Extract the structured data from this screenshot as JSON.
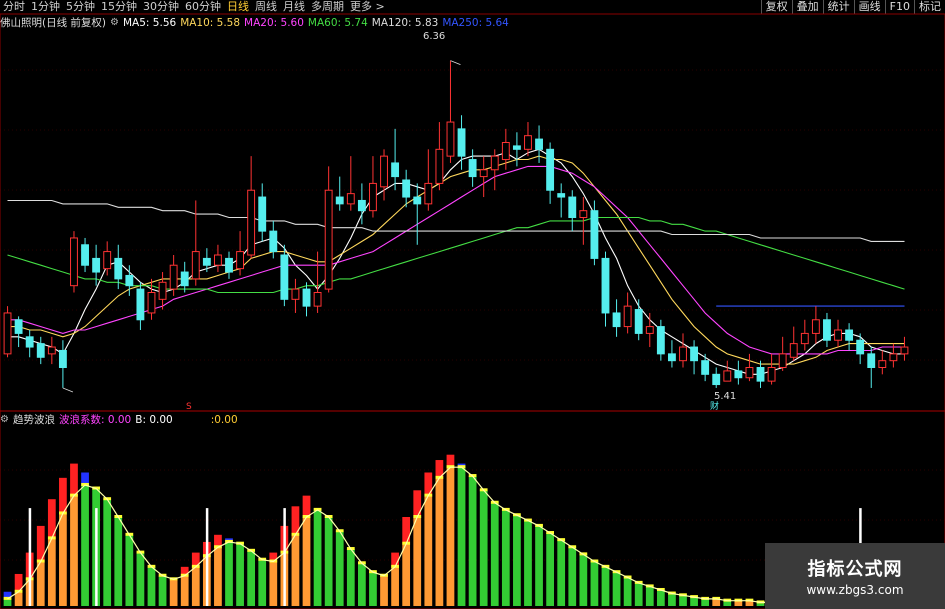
{
  "toolbar": {
    "tabs": [
      "分时",
      "1分钟",
      "5分钟",
      "15分钟",
      "30分钟",
      "60分钟",
      "日线",
      "周线",
      "月线",
      "多周期",
      "更多"
    ],
    "active_tab": "日线",
    "more_arrow": ">",
    "right_buttons": [
      "复权",
      "叠加",
      "统计",
      "画线",
      "F10",
      "标记"
    ]
  },
  "chart_header": {
    "stock": "佛山照明(日线 前复权)",
    "ma": [
      {
        "label": "MA5: 5.56",
        "color": "#ffffff"
      },
      {
        "label": "MA10: 5.58",
        "color": "#ffd85c"
      },
      {
        "label": "MA20: 5.60",
        "color": "#ff44ff"
      },
      {
        "label": "MA60: 5.74",
        "color": "#44dd44"
      },
      {
        "label": "MA120: 5.83",
        "color": "#dddddd"
      },
      {
        "label": "MA250: 5.64",
        "color": "#3355ff"
      }
    ]
  },
  "price_annotations": {
    "high": "6.36",
    "low": "5.41",
    "marker_s": "S",
    "marker_cai": "财"
  },
  "indicator_header": {
    "name": "趋势波浪",
    "params": [
      {
        "label": "波浪系数: 0.00",
        "color": "#ff44ff"
      },
      {
        "label": "B: 0.00",
        "color": "#ffffff"
      },
      {
        "label": ":0.00",
        "color": "#ffcc33"
      }
    ]
  },
  "watermark": {
    "title": "指标公式网",
    "url": "www.zbgs3.com"
  },
  "colors": {
    "up": "#ff3333",
    "down": "#55eeee",
    "ma5": "#ffffff",
    "ma10": "#ffd85c",
    "ma20": "#ff44ff",
    "ma60": "#44dd44",
    "ma120": "#dddddd",
    "ma250": "#3355ff",
    "grid": "#5a0000"
  },
  "chart_data": [
    {
      "type": "candlestick",
      "title": "佛山照明(日线 前复权)",
      "high_label": 6.36,
      "low_label": 5.41,
      "ylim": [
        5.35,
        6.45
      ],
      "candles": [
        [
          5.5,
          5.62,
          5.64,
          5.49
        ],
        [
          5.6,
          5.56,
          5.61,
          5.52
        ],
        [
          5.55,
          5.52,
          5.57,
          5.49
        ],
        [
          5.53,
          5.49,
          5.55,
          5.47
        ],
        [
          5.5,
          5.52,
          5.55,
          5.47
        ],
        [
          5.51,
          5.46,
          5.54,
          5.4
        ],
        [
          5.7,
          5.84,
          5.86,
          5.68
        ],
        [
          5.82,
          5.76,
          5.84,
          5.74
        ],
        [
          5.78,
          5.74,
          5.82,
          5.7
        ],
        [
          5.75,
          5.8,
          5.83,
          5.73
        ],
        [
          5.78,
          5.72,
          5.82,
          5.69
        ],
        [
          5.73,
          5.7,
          5.76,
          5.67
        ],
        [
          5.69,
          5.6,
          5.71,
          5.57
        ],
        [
          5.62,
          5.68,
          5.72,
          5.6
        ],
        [
          5.66,
          5.71,
          5.74,
          5.63
        ],
        [
          5.69,
          5.76,
          5.79,
          5.67
        ],
        [
          5.74,
          5.7,
          5.77,
          5.68
        ],
        [
          5.72,
          5.8,
          5.95,
          5.7
        ],
        [
          5.78,
          5.76,
          5.81,
          5.74
        ],
        [
          5.76,
          5.79,
          5.82,
          5.74
        ],
        [
          5.78,
          5.74,
          5.8,
          5.72
        ],
        [
          5.75,
          5.8,
          5.86,
          5.73
        ],
        [
          5.79,
          5.98,
          6.08,
          5.78
        ],
        [
          5.96,
          5.86,
          6.0,
          5.83
        ],
        [
          5.86,
          5.8,
          5.89,
          5.78
        ],
        [
          5.79,
          5.66,
          5.82,
          5.64
        ],
        [
          5.66,
          5.69,
          5.72,
          5.62
        ],
        [
          5.69,
          5.64,
          5.71,
          5.61
        ],
        [
          5.64,
          5.68,
          5.8,
          5.62
        ],
        [
          5.69,
          5.98,
          6.05,
          5.68
        ],
        [
          5.96,
          5.94,
          6.02,
          5.92
        ],
        [
          5.94,
          5.97,
          6.08,
          5.92
        ],
        [
          5.95,
          5.92,
          6.0,
          5.88
        ],
        [
          5.92,
          6.0,
          6.08,
          5.9
        ],
        [
          5.99,
          6.08,
          6.1,
          5.95
        ],
        [
          6.06,
          6.02,
          6.16,
          5.98
        ],
        [
          6.01,
          5.96,
          6.04,
          5.93
        ],
        [
          5.96,
          5.94,
          6.0,
          5.82
        ],
        [
          5.94,
          6.0,
          6.1,
          5.92
        ],
        [
          6.0,
          6.1,
          6.18,
          5.98
        ],
        [
          6.08,
          6.18,
          6.36,
          6.06
        ],
        [
          6.16,
          6.08,
          6.2,
          6.04
        ],
        [
          6.07,
          6.02,
          6.1,
          5.99
        ],
        [
          6.02,
          6.04,
          6.08,
          5.96
        ],
        [
          6.04,
          6.08,
          6.1,
          5.98
        ],
        [
          6.07,
          6.12,
          6.16,
          6.04
        ],
        [
          6.11,
          6.1,
          6.15,
          6.05
        ],
        [
          6.1,
          6.14,
          6.18,
          6.08
        ],
        [
          6.13,
          6.1,
          6.17,
          6.06
        ],
        [
          6.1,
          5.98,
          6.12,
          5.94
        ],
        [
          5.97,
          5.96,
          6.0,
          5.9
        ],
        [
          5.96,
          5.9,
          5.98,
          5.86
        ],
        [
          5.9,
          5.92,
          5.96,
          5.82
        ],
        [
          5.92,
          5.78,
          5.95,
          5.76
        ],
        [
          5.78,
          5.62,
          5.8,
          5.58
        ],
        [
          5.62,
          5.58,
          5.66,
          5.55
        ],
        [
          5.58,
          5.64,
          5.68,
          5.56
        ],
        [
          5.63,
          5.56,
          5.66,
          5.54
        ],
        [
          5.56,
          5.58,
          5.62,
          5.52
        ],
        [
          5.58,
          5.5,
          5.6,
          5.48
        ],
        [
          5.5,
          5.48,
          5.54,
          5.46
        ],
        [
          5.48,
          5.52,
          5.56,
          5.46
        ],
        [
          5.52,
          5.48,
          5.54,
          5.44
        ],
        [
          5.48,
          5.44,
          5.5,
          5.42
        ],
        [
          5.44,
          5.41,
          5.46,
          5.4
        ],
        [
          5.42,
          5.45,
          5.48,
          5.42
        ],
        [
          5.45,
          5.43,
          5.48,
          5.41
        ],
        [
          5.43,
          5.46,
          5.5,
          5.42
        ],
        [
          5.46,
          5.42,
          5.48,
          5.4
        ],
        [
          5.42,
          5.46,
          5.5,
          5.41
        ],
        [
          5.46,
          5.5,
          5.55,
          5.45
        ],
        [
          5.49,
          5.53,
          5.58,
          5.48
        ],
        [
          5.53,
          5.56,
          5.6,
          5.51
        ],
        [
          5.56,
          5.6,
          5.64,
          5.53
        ],
        [
          5.6,
          5.54,
          5.62,
          5.52
        ],
        [
          5.54,
          5.57,
          5.6,
          5.52
        ],
        [
          5.57,
          5.54,
          5.59,
          5.51
        ],
        [
          5.54,
          5.5,
          5.56,
          5.47
        ],
        [
          5.5,
          5.46,
          5.52,
          5.4
        ],
        [
          5.46,
          5.48,
          5.51,
          5.44
        ],
        [
          5.48,
          5.5,
          5.53,
          5.46
        ],
        [
          5.5,
          5.52,
          5.55,
          5.48
        ]
      ],
      "ma_lines": {
        "MA5": [
          5.55,
          5.55,
          5.54,
          5.53,
          5.52,
          5.5,
          5.56,
          5.63,
          5.69,
          5.76,
          5.77,
          5.74,
          5.71,
          5.69,
          5.68,
          5.69,
          5.71,
          5.74,
          5.75,
          5.76,
          5.76,
          5.78,
          5.82,
          5.83,
          5.84,
          5.81,
          5.76,
          5.73,
          5.69,
          5.73,
          5.78,
          5.84,
          5.91,
          5.96,
          5.98,
          6.0,
          6.0,
          5.99,
          5.98,
          6.0,
          6.04,
          6.07,
          6.08,
          6.08,
          6.08,
          6.09,
          6.07,
          6.09,
          6.1,
          6.08,
          6.06,
          6.02,
          5.97,
          5.91,
          5.84,
          5.78,
          5.7,
          5.64,
          5.6,
          5.57,
          5.55,
          5.53,
          5.51,
          5.49,
          5.47,
          5.46,
          5.45,
          5.44,
          5.44,
          5.45,
          5.46,
          5.48,
          5.5,
          5.53,
          5.55,
          5.56,
          5.56,
          5.55,
          5.52,
          5.51,
          5.5,
          5.5
        ],
        "MA10": [
          5.58,
          5.58,
          5.57,
          5.57,
          5.56,
          5.55,
          5.56,
          5.58,
          5.61,
          5.64,
          5.67,
          5.69,
          5.7,
          5.71,
          5.72,
          5.72,
          5.72,
          5.72,
          5.72,
          5.73,
          5.74,
          5.75,
          5.78,
          5.79,
          5.8,
          5.8,
          5.79,
          5.78,
          5.77,
          5.77,
          5.79,
          5.81,
          5.83,
          5.85,
          5.88,
          5.91,
          5.94,
          5.96,
          5.98,
          6.0,
          6.02,
          6.03,
          6.04,
          6.04,
          6.05,
          6.06,
          6.07,
          6.07,
          6.08,
          6.07,
          6.07,
          6.06,
          6.03,
          5.99,
          5.95,
          5.91,
          5.86,
          5.81,
          5.76,
          5.71,
          5.66,
          5.62,
          5.58,
          5.55,
          5.52,
          5.5,
          5.49,
          5.48,
          5.47,
          5.47,
          5.47,
          5.47,
          5.48,
          5.49,
          5.51,
          5.52,
          5.53,
          5.53,
          5.53,
          5.53,
          5.53,
          5.53
        ],
        "MA20": [
          5.6,
          5.6,
          5.59,
          5.58,
          5.57,
          5.56,
          5.57,
          5.57,
          5.58,
          5.59,
          5.6,
          5.61,
          5.62,
          5.63,
          5.64,
          5.66,
          5.67,
          5.68,
          5.69,
          5.7,
          5.71,
          5.72,
          5.73,
          5.74,
          5.75,
          5.76,
          5.76,
          5.76,
          5.76,
          5.76,
          5.77,
          5.78,
          5.79,
          5.8,
          5.82,
          5.84,
          5.86,
          5.88,
          5.9,
          5.92,
          5.94,
          5.96,
          5.98,
          6.0,
          6.02,
          6.03,
          6.04,
          6.05,
          6.05,
          6.05,
          6.04,
          6.03,
          6.01,
          5.99,
          5.96,
          5.93,
          5.9,
          5.86,
          5.82,
          5.78,
          5.74,
          5.7,
          5.66,
          5.62,
          5.59,
          5.56,
          5.54,
          5.52,
          5.51,
          5.5,
          5.5,
          5.5,
          5.5,
          5.5,
          5.5,
          5.51,
          5.51,
          5.51,
          5.51,
          5.52,
          5.52,
          5.52
        ],
        "MA60": [
          5.79,
          5.78,
          5.77,
          5.76,
          5.75,
          5.74,
          5.73,
          5.72,
          5.72,
          5.71,
          5.71,
          5.7,
          5.7,
          5.7,
          5.69,
          5.69,
          5.69,
          5.69,
          5.69,
          5.68,
          5.68,
          5.68,
          5.68,
          5.68,
          5.68,
          5.69,
          5.69,
          5.7,
          5.7,
          5.71,
          5.72,
          5.72,
          5.73,
          5.74,
          5.75,
          5.76,
          5.77,
          5.78,
          5.79,
          5.8,
          5.81,
          5.82,
          5.83,
          5.84,
          5.85,
          5.86,
          5.87,
          5.87,
          5.88,
          5.89,
          5.89,
          5.89,
          5.89,
          5.9,
          5.9,
          5.9,
          5.9,
          5.9,
          5.89,
          5.89,
          5.88,
          5.88,
          5.87,
          5.86,
          5.86,
          5.85,
          5.84,
          5.83,
          5.82,
          5.81,
          5.8,
          5.79,
          5.78,
          5.77,
          5.76,
          5.75,
          5.74,
          5.73,
          5.72,
          5.71,
          5.7,
          5.69
        ],
        "MA120": [
          5.95,
          5.95,
          5.95,
          5.95,
          5.95,
          5.94,
          5.94,
          5.94,
          5.94,
          5.94,
          5.93,
          5.93,
          5.93,
          5.93,
          5.92,
          5.92,
          5.92,
          5.91,
          5.91,
          5.91,
          5.9,
          5.9,
          5.9,
          5.89,
          5.89,
          5.89,
          5.88,
          5.88,
          5.88,
          5.87,
          5.87,
          5.87,
          5.87,
          5.86,
          5.86,
          5.86,
          5.86,
          5.86,
          5.86,
          5.86,
          5.86,
          5.86,
          5.86,
          5.86,
          5.86,
          5.86,
          5.86,
          5.86,
          5.86,
          5.86,
          5.86,
          5.86,
          5.86,
          5.86,
          5.86,
          5.86,
          5.86,
          5.86,
          5.86,
          5.86,
          5.85,
          5.85,
          5.85,
          5.85,
          5.85,
          5.85,
          5.85,
          5.85,
          5.84,
          5.84,
          5.84,
          5.84,
          5.84,
          5.84,
          5.84,
          5.84,
          5.84,
          5.84,
          5.83,
          5.83,
          5.83,
          5.83
        ],
        "MA250": [
          null,
          null,
          null,
          null,
          null,
          null,
          null,
          null,
          null,
          null,
          null,
          null,
          null,
          null,
          null,
          null,
          null,
          null,
          null,
          null,
          null,
          null,
          null,
          null,
          null,
          null,
          null,
          null,
          null,
          null,
          null,
          null,
          null,
          null,
          null,
          null,
          null,
          null,
          null,
          null,
          null,
          null,
          null,
          null,
          null,
          null,
          null,
          null,
          null,
          null,
          null,
          null,
          null,
          null,
          null,
          null,
          null,
          null,
          null,
          null,
          null,
          null,
          null,
          null,
          5.64,
          5.64,
          5.64,
          5.64,
          5.64,
          5.64,
          5.64,
          5.64,
          5.64,
          5.64,
          5.64,
          5.64,
          5.64,
          5.64,
          5.64,
          5.64,
          5.64,
          5.64
        ]
      }
    },
    {
      "type": "bar",
      "title": "趋势波浪",
      "ylim": [
        0,
        100
      ],
      "values": [
        8,
        18,
        30,
        45,
        60,
        72,
        80,
        75,
        62,
        48,
        35,
        25,
        18,
        14,
        12,
        15,
        22,
        30,
        36,
        40,
        38,
        32,
        25,
        22,
        30,
        45,
        56,
        62,
        55,
        40,
        28,
        20,
        16,
        14,
        18,
        30,
        50,
        65,
        75,
        82,
        85,
        80,
        70,
        60,
        55,
        52,
        50,
        46,
        42,
        38,
        35,
        30,
        26,
        22,
        20,
        18,
        15,
        12,
        10,
        8,
        7,
        6,
        5,
        4,
        4,
        3,
        3,
        3,
        2,
        2,
        2,
        2,
        2,
        2,
        2,
        1,
        1,
        1,
        1,
        1,
        1,
        1
      ],
      "overlay_values": [
        4,
        8,
        15,
        25,
        38,
        52,
        62,
        68,
        66,
        60,
        50,
        40,
        30,
        22,
        17,
        15,
        17,
        22,
        28,
        33,
        36,
        35,
        31,
        26,
        25,
        30,
        40,
        50,
        54,
        50,
        42,
        32,
        24,
        19,
        17,
        22,
        35,
        50,
        62,
        72,
        78,
        78,
        73,
        65,
        58,
        54,
        51,
        48,
        45,
        41,
        37,
        33,
        29,
        25,
        22,
        19,
        16,
        13,
        11,
        9,
        7,
        6,
        5,
        4,
        4,
        3,
        3,
        3,
        2,
        2,
        2,
        2,
        2,
        2,
        2,
        1,
        1,
        1,
        1,
        1,
        1,
        1
      ],
      "signal_bars": [
        2,
        8,
        18,
        25,
        77,
        86
      ]
    }
  ]
}
